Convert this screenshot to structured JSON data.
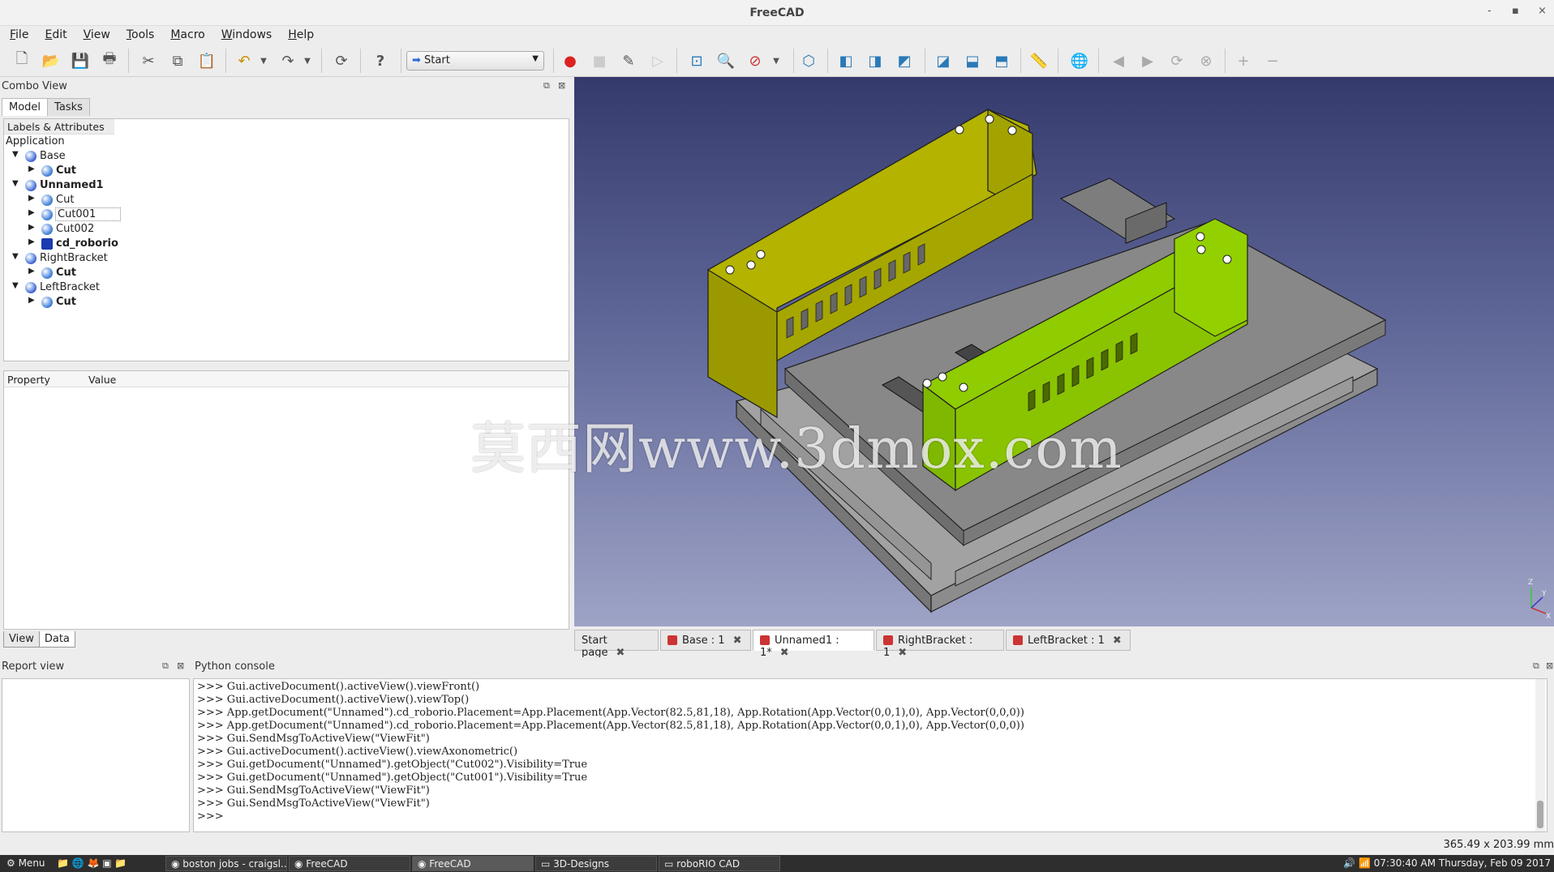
{
  "window": {
    "title": "FreeCAD",
    "controls": [
      "-",
      "▪",
      "×"
    ]
  },
  "menu": [
    "File",
    "Edit",
    "View",
    "Tools",
    "Macro",
    "Windows",
    "Help"
  ],
  "toolbar": {
    "workbench": "Start"
  },
  "combo": {
    "title": "Combo View",
    "tabs": [
      "Model",
      "Tasks"
    ],
    "active_tab": "Model"
  },
  "tree": {
    "header": "Labels & Attributes",
    "root": "Application",
    "items": [
      {
        "label": "Base",
        "bold": false,
        "level": 0
      },
      {
        "label": "Cut",
        "bold": true,
        "level": 1
      },
      {
        "label": "Unnamed1",
        "bold": true,
        "level": 0
      },
      {
        "label": "Cut",
        "bold": false,
        "level": 1
      },
      {
        "label": "Cut001",
        "bold": false,
        "level": 1
      },
      {
        "label": "Cut002",
        "bold": false,
        "level": 1
      },
      {
        "label": "cd_roborio",
        "bold": true,
        "level": 1
      },
      {
        "label": "RightBracket",
        "bold": false,
        "level": 0
      },
      {
        "label": "Cut",
        "bold": true,
        "level": 1
      },
      {
        "label": "LeftBracket",
        "bold": false,
        "level": 0
      },
      {
        "label": "Cut",
        "bold": true,
        "level": 1
      }
    ]
  },
  "props": {
    "col_property": "Property",
    "col_value": "Value",
    "tabs": [
      "View",
      "Data"
    ],
    "active_tab": "Data"
  },
  "doc_tabs": [
    {
      "label": "Start page",
      "active": false
    },
    {
      "label": "Base : 1",
      "active": false
    },
    {
      "label": "Unnamed1 : 1*",
      "active": true
    },
    {
      "label": "RightBracket : 1",
      "active": false
    },
    {
      "label": "LeftBracket : 1",
      "active": false
    }
  ],
  "report": {
    "title": "Report view"
  },
  "python": {
    "title": "Python console",
    "lines": [
      ">>> Gui.activeDocument().activeView().viewFront()",
      ">>> Gui.activeDocument().activeView().viewTop()",
      ">>> App.getDocument(\"Unnamed\").cd_roborio.Placement=App.Placement(App.Vector(82.5,81,18), App.Rotation(App.Vector(0,0,1),0), App.Vector(0,0,0))",
      ">>> App.getDocument(\"Unnamed\").cd_roborio.Placement=App.Placement(App.Vector(82.5,81,18), App.Rotation(App.Vector(0,0,1),0), App.Vector(0,0,0))",
      ">>> Gui.SendMsgToActiveView(\"ViewFit\")",
      ">>> Gui.activeDocument().activeView().viewAxonometric()",
      ">>> Gui.getDocument(\"Unnamed\").getObject(\"Cut002\").Visibility=True",
      ">>> Gui.getDocument(\"Unnamed\").getObject(\"Cut001\").Visibility=True",
      ">>> Gui.SendMsgToActiveView(\"ViewFit\")",
      ">>> Gui.SendMsgToActiveView(\"ViewFit\")",
      ">>>"
    ]
  },
  "status": {
    "dimensions": "365.49 x 203.99 mm"
  },
  "watermark": "莫西网www.3dmox.com",
  "axis": {
    "x": "X",
    "y": "Y",
    "z": "Z"
  },
  "taskbar": {
    "menu": "Menu",
    "tasks": [
      {
        "label": "boston jobs - craigsl...",
        "active": false
      },
      {
        "label": "FreeCAD",
        "active": false
      },
      {
        "label": "FreeCAD",
        "active": true
      },
      {
        "label": "3D-Designs",
        "active": false
      },
      {
        "label": "roboRIO CAD",
        "active": false
      }
    ],
    "clock": "07:30:40 AM Thursday, Feb 09 2017"
  },
  "colors": {
    "yellow_bracket": "#b3b300",
    "green_bracket": "#8fcc00",
    "board": "#8a8a8a",
    "viewport_top": "#353a6c",
    "viewport_bottom": "#9ea3c6"
  }
}
